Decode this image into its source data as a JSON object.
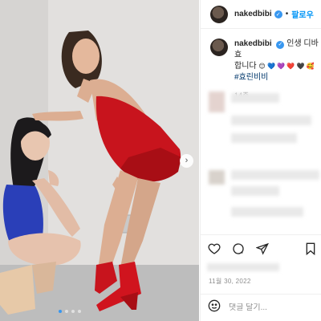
{
  "post": {
    "image_alt": "Two performers posing against a white wall, one in a red outfit and red boots, one in a blue outfit crouching",
    "carousel_total": 4,
    "carousel_active": 1
  },
  "header": {
    "username": "nakedbibi",
    "separator": "•",
    "follow_label": "팔로우"
  },
  "caption": {
    "username": "nakedbibi",
    "text": "인생 디바 효",
    "line2": "합니다",
    "hashtag": "효린비비",
    "time_ago": "14주"
  },
  "date": "11월 30, 2022",
  "comment": {
    "placeholder": "댓글 달기..."
  },
  "icons": {
    "like": "heart-icon",
    "comment": "comment-icon",
    "share": "share-icon",
    "save": "bookmark-icon",
    "emoji": "smiley-icon",
    "verified": "verified-badge-icon",
    "next": "chevron-right-icon"
  },
  "colors": {
    "accent": "#0095f6",
    "verified": "#3897f0",
    "hashtag": "#00376b",
    "muted": "#8e8e8e"
  }
}
